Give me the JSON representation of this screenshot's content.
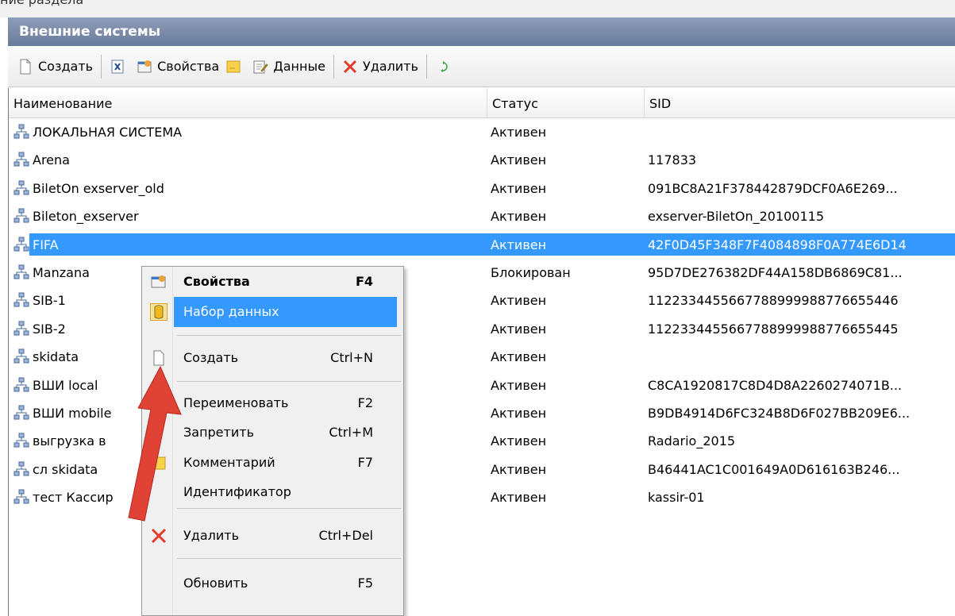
{
  "top_strip_text": "ние раздела",
  "window": {
    "title": "Внешние системы"
  },
  "toolbar": {
    "create_label": "Создать",
    "properties_label": "Свойства",
    "data_label": "Данные",
    "delete_label": "Удалить"
  },
  "columns": {
    "name": "Наименование",
    "status": "Статус",
    "sid": "SID"
  },
  "rows": [
    {
      "name": "ЛОКАЛЬНАЯ СИСТЕМА",
      "status": "Активен",
      "sid": ""
    },
    {
      "name": "Arena",
      "status": "Активен",
      "sid": "117833"
    },
    {
      "name": "BiletOn exserver_old",
      "status": "Активен",
      "sid": "091BC8A21F378442879DCF0A6E269..."
    },
    {
      "name": "Bileton_exserver",
      "status": "Активен",
      "sid": "exserver-BiletOn_20100115"
    },
    {
      "name": "FIFA",
      "status": "Активен",
      "sid": "42F0D45F348F7F4084898F0A774E6D14"
    },
    {
      "name": "Manzana",
      "status": "Блокирован",
      "sid": "95D7DE276382DF44A158DB6869C81..."
    },
    {
      "name": "SIB-1",
      "status": "Активен",
      "sid": "1122334455667788999988776655446"
    },
    {
      "name": "SIB-2",
      "status": "Активен",
      "sid": "1122334455667788999988776655445"
    },
    {
      "name": "skidata",
      "status": "Активен",
      "sid": ""
    },
    {
      "name": "ВШИ local",
      "status": "Активен",
      "sid": "C8CA1920817C8D4D8A2260274071B..."
    },
    {
      "name": "ВШИ mobile",
      "status": "Активен",
      "sid": "B9DB4914D6FC324B8D6F027BB209E6..."
    },
    {
      "name": "выгрузка в",
      "status": "Активен",
      "sid": "Radario_2015"
    },
    {
      "name": "сл skidata",
      "status": "Активен",
      "sid": "B46441AC1C001649A0D616163B246..."
    },
    {
      "name": "тест Кассир",
      "status": "Активен",
      "sid": "kassir-01"
    }
  ],
  "selected_row_index": 4,
  "context_menu": {
    "properties": {
      "label": "Свойства",
      "shortcut": "F4"
    },
    "dataset": {
      "label": "Набор данных"
    },
    "create": {
      "label": "Создать",
      "shortcut": "Ctrl+N"
    },
    "rename": {
      "label": "Переименовать",
      "shortcut": "F2"
    },
    "forbid": {
      "label": "Запретить",
      "shortcut": "Ctrl+M"
    },
    "comment": {
      "label": "Комментарий",
      "shortcut": "F7"
    },
    "identifier": {
      "label": "Идентификатор"
    },
    "delete": {
      "label": "Удалить",
      "shortcut": "Ctrl+Del"
    },
    "refresh": {
      "label": "Обновить",
      "shortcut": "F5"
    }
  },
  "colors": {
    "title_bar": "#7b8aa8",
    "selection": "#3399ff",
    "arrow": "#e04236",
    "delete_icon": "#e53a2a"
  }
}
